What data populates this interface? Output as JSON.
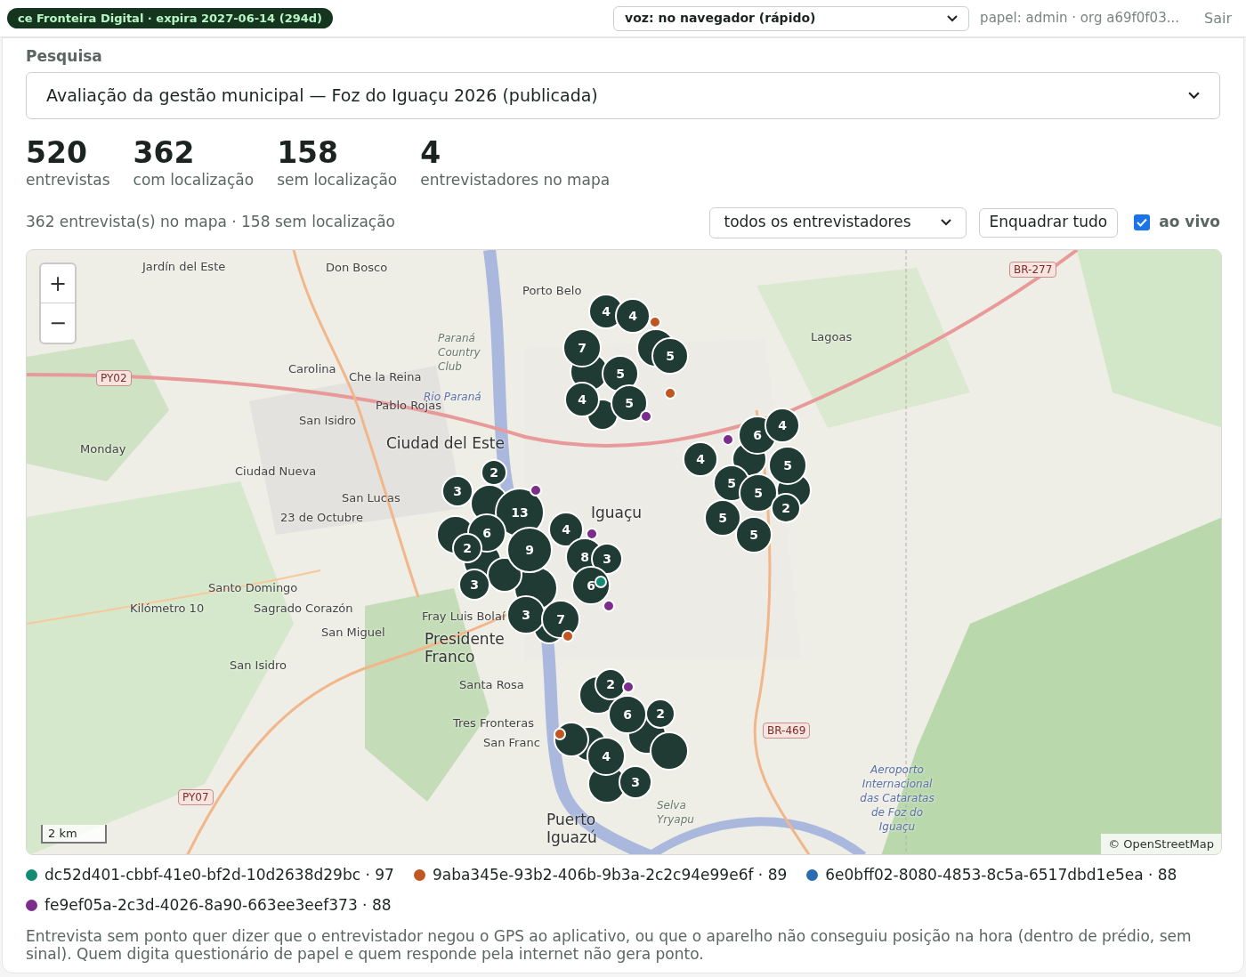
{
  "topbar": {
    "badge": "ce Fronteira Digital · expira 2027-06-14 (294d)",
    "voice_select": "voz: no navegador (rápido)",
    "role": "papel: admin · org a69f0f03...",
    "logout": "Sair"
  },
  "survey": {
    "label": "Pesquisa",
    "value": "Avaliação da gestão municipal — Foz do Iguaçu 2026 (publicada)"
  },
  "stats": [
    {
      "value": "520",
      "label": "entrevistas"
    },
    {
      "value": "362",
      "label": "com localização"
    },
    {
      "value": "158",
      "label": "sem localização"
    },
    {
      "value": "4",
      "label": "entrevistadores no mapa"
    }
  ],
  "summary": "362 entrevista(s) no mapa · 158 sem localização",
  "filter": {
    "value": "todos os entrevistadores"
  },
  "fit_button": "Enquadrar tudo",
  "live": {
    "label": "ao vivo",
    "checked": true
  },
  "map": {
    "zoom_in": "+",
    "zoom_out": "−",
    "scale": "2 km",
    "attribution": "© OpenStreetMap",
    "labels": [
      {
        "text": "Jardín del Este",
        "kind": "place"
      },
      {
        "text": "Don Bosco",
        "kind": "place"
      },
      {
        "text": "Porto Belo",
        "kind": "place"
      },
      {
        "text": "Lagoas",
        "kind": "place"
      },
      {
        "text": "BR-277",
        "kind": "road"
      },
      {
        "text": "PY02",
        "kind": "road"
      },
      {
        "text": "Carolina",
        "kind": "place"
      },
      {
        "text": "Che la Reina",
        "kind": "place"
      },
      {
        "text": "Pablo Rojas",
        "kind": "place"
      },
      {
        "text": "San Isidro",
        "kind": "place"
      },
      {
        "text": "Monday",
        "kind": "place"
      },
      {
        "text": "Ciudad Nueva",
        "kind": "place"
      },
      {
        "text": "San Lucas",
        "kind": "place"
      },
      {
        "text": "23 de Octubre",
        "kind": "place"
      },
      {
        "text": "Ciudad del Este",
        "kind": "city"
      },
      {
        "text": "Iguaçu",
        "kind": "city"
      },
      {
        "text": "Santo Domingo",
        "kind": "place"
      },
      {
        "text": "Kilómetro 10",
        "kind": "place"
      },
      {
        "text": "Sagrado Corazón",
        "kind": "place"
      },
      {
        "text": "San Miguel",
        "kind": "place"
      },
      {
        "text": "Fray Luis Bolaí",
        "kind": "place"
      },
      {
        "text": "San Isidro",
        "kind": "place"
      },
      {
        "text": "Presidente Franco",
        "kind": "city"
      },
      {
        "text": "Santa Rosa",
        "kind": "place"
      },
      {
        "text": "Tres Fronteras",
        "kind": "place"
      },
      {
        "text": "San Franc",
        "kind": "place"
      },
      {
        "text": "Puerto Iguazú",
        "kind": "city"
      },
      {
        "text": "Selva Yryapu",
        "kind": "park"
      },
      {
        "text": "BR-469",
        "kind": "road"
      },
      {
        "text": "PY07",
        "kind": "road"
      },
      {
        "text": "Aeroporto Internacional das Cataratas de Foz do Iguaçu",
        "kind": "water"
      },
      {
        "text": "Paraná Country Club",
        "kind": "park"
      },
      {
        "text": "Rio Paraná",
        "kind": "water"
      }
    ],
    "clusters": [
      {
        "count": "4"
      },
      {
        "count": "4"
      },
      {
        "count": "7"
      },
      {
        "count": "5"
      },
      {
        "count": "5"
      },
      {
        "count": "4"
      },
      {
        "count": "5"
      },
      {
        "count": "6"
      },
      {
        "count": "4"
      },
      {
        "count": "4"
      },
      {
        "count": "5"
      },
      {
        "count": "5"
      },
      {
        "count": "5"
      },
      {
        "count": "2"
      },
      {
        "count": "5"
      },
      {
        "count": "5"
      },
      {
        "count": "2"
      },
      {
        "count": "3"
      },
      {
        "count": "13"
      },
      {
        "count": "4"
      },
      {
        "count": "6"
      },
      {
        "count": "2"
      },
      {
        "count": "9"
      },
      {
        "count": "8"
      },
      {
        "count": "3"
      },
      {
        "count": "3"
      },
      {
        "count": "6"
      },
      {
        "count": "3"
      },
      {
        "count": "7"
      },
      {
        "count": "2"
      },
      {
        "count": "6"
      },
      {
        "count": "2"
      },
      {
        "count": "4"
      },
      {
        "count": "3"
      }
    ]
  },
  "legend": [
    {
      "label": "dc52d401-cbbf-41e0-bf2d-10d2638d29bc · 97",
      "color": "#138a72"
    },
    {
      "label": "9aba345e-93b2-406b-9b3a-2c2c94e99e6f · 89",
      "color": "#c05621"
    },
    {
      "label": "6e0bff02-8080-4853-8c5a-6517dbd1e5ea · 88",
      "color": "#2b6cb0"
    },
    {
      "label": "fe9ef05a-2c3d-4026-8a90-663ee3eef373 · 88",
      "color": "#7b2d8e"
    }
  ],
  "note": "Entrevista sem ponto quer dizer que o entrevistador negou o GPS ao aplicativo, ou que o aparelho não conseguiu posição na hora (dentro de prédio, sem sinal). Quem digita questionário de papel e quem responde pela internet não gera ponto."
}
